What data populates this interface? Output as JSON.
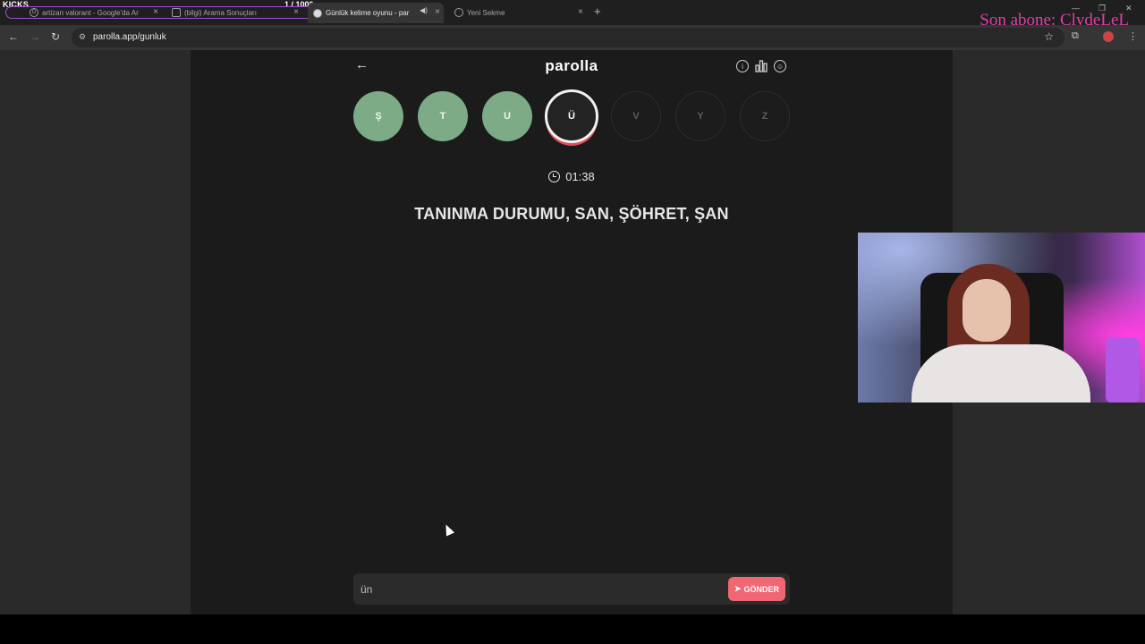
{
  "stream_overlay": {
    "kicks_label": "KICKS",
    "goal": "1  / 1000",
    "subscriber_text": "Son abone: ClydeLeL"
  },
  "browser": {
    "tabs": [
      {
        "title": "artizan valorant - Google'da Ar",
        "icon": "google-icon",
        "active": false
      },
      {
        "title": "(bilgi) Arama Sonuçları",
        "icon": "page-icon",
        "active": false
      },
      {
        "title": "Günlük kelime oyunu - par",
        "icon": "parolla-icon",
        "active": true
      },
      {
        "title": "Yeni Sekme",
        "icon": "chrome-icon",
        "active": false
      }
    ],
    "new_tab_symbol": "+",
    "url": "parolla.app/gunluk"
  },
  "app": {
    "brand": "parolla",
    "letters": [
      {
        "char": "Ş",
        "state": "done"
      },
      {
        "char": "T",
        "state": "done"
      },
      {
        "char": "U",
        "state": "done"
      },
      {
        "char": "Ü",
        "state": "current"
      },
      {
        "char": "V",
        "state": "pending"
      },
      {
        "char": "Y",
        "state": "pending"
      },
      {
        "char": "Z",
        "state": "pending"
      }
    ],
    "timer": "01:38",
    "question": "TANINMA DURUMU, SAN, ŞÖHRET, ŞAN",
    "answer_value": "ün",
    "send_label": "GÖNDER"
  },
  "colors": {
    "letter_done": "#7cab85",
    "send_button": "#f06672",
    "current_ring_accent": "#e24b58",
    "subscriber_text": "#e23ea8"
  }
}
